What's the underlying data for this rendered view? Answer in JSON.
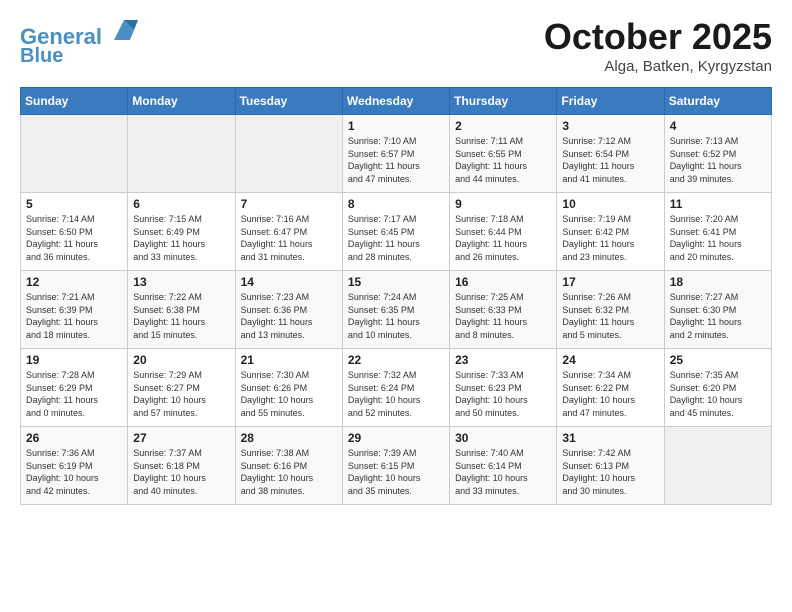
{
  "header": {
    "logo_line1": "General",
    "logo_line2": "Blue",
    "month_title": "October 2025",
    "subtitle": "Alga, Batken, Kyrgyzstan"
  },
  "days_of_week": [
    "Sunday",
    "Monday",
    "Tuesday",
    "Wednesday",
    "Thursday",
    "Friday",
    "Saturday"
  ],
  "weeks": [
    [
      {
        "day": "",
        "info": ""
      },
      {
        "day": "",
        "info": ""
      },
      {
        "day": "",
        "info": ""
      },
      {
        "day": "1",
        "info": "Sunrise: 7:10 AM\nSunset: 6:57 PM\nDaylight: 11 hours\nand 47 minutes."
      },
      {
        "day": "2",
        "info": "Sunrise: 7:11 AM\nSunset: 6:55 PM\nDaylight: 11 hours\nand 44 minutes."
      },
      {
        "day": "3",
        "info": "Sunrise: 7:12 AM\nSunset: 6:54 PM\nDaylight: 11 hours\nand 41 minutes."
      },
      {
        "day": "4",
        "info": "Sunrise: 7:13 AM\nSunset: 6:52 PM\nDaylight: 11 hours\nand 39 minutes."
      }
    ],
    [
      {
        "day": "5",
        "info": "Sunrise: 7:14 AM\nSunset: 6:50 PM\nDaylight: 11 hours\nand 36 minutes."
      },
      {
        "day": "6",
        "info": "Sunrise: 7:15 AM\nSunset: 6:49 PM\nDaylight: 11 hours\nand 33 minutes."
      },
      {
        "day": "7",
        "info": "Sunrise: 7:16 AM\nSunset: 6:47 PM\nDaylight: 11 hours\nand 31 minutes."
      },
      {
        "day": "8",
        "info": "Sunrise: 7:17 AM\nSunset: 6:45 PM\nDaylight: 11 hours\nand 28 minutes."
      },
      {
        "day": "9",
        "info": "Sunrise: 7:18 AM\nSunset: 6:44 PM\nDaylight: 11 hours\nand 26 minutes."
      },
      {
        "day": "10",
        "info": "Sunrise: 7:19 AM\nSunset: 6:42 PM\nDaylight: 11 hours\nand 23 minutes."
      },
      {
        "day": "11",
        "info": "Sunrise: 7:20 AM\nSunset: 6:41 PM\nDaylight: 11 hours\nand 20 minutes."
      }
    ],
    [
      {
        "day": "12",
        "info": "Sunrise: 7:21 AM\nSunset: 6:39 PM\nDaylight: 11 hours\nand 18 minutes."
      },
      {
        "day": "13",
        "info": "Sunrise: 7:22 AM\nSunset: 6:38 PM\nDaylight: 11 hours\nand 15 minutes."
      },
      {
        "day": "14",
        "info": "Sunrise: 7:23 AM\nSunset: 6:36 PM\nDaylight: 11 hours\nand 13 minutes."
      },
      {
        "day": "15",
        "info": "Sunrise: 7:24 AM\nSunset: 6:35 PM\nDaylight: 11 hours\nand 10 minutes."
      },
      {
        "day": "16",
        "info": "Sunrise: 7:25 AM\nSunset: 6:33 PM\nDaylight: 11 hours\nand 8 minutes."
      },
      {
        "day": "17",
        "info": "Sunrise: 7:26 AM\nSunset: 6:32 PM\nDaylight: 11 hours\nand 5 minutes."
      },
      {
        "day": "18",
        "info": "Sunrise: 7:27 AM\nSunset: 6:30 PM\nDaylight: 11 hours\nand 2 minutes."
      }
    ],
    [
      {
        "day": "19",
        "info": "Sunrise: 7:28 AM\nSunset: 6:29 PM\nDaylight: 11 hours\nand 0 minutes."
      },
      {
        "day": "20",
        "info": "Sunrise: 7:29 AM\nSunset: 6:27 PM\nDaylight: 10 hours\nand 57 minutes."
      },
      {
        "day": "21",
        "info": "Sunrise: 7:30 AM\nSunset: 6:26 PM\nDaylight: 10 hours\nand 55 minutes."
      },
      {
        "day": "22",
        "info": "Sunrise: 7:32 AM\nSunset: 6:24 PM\nDaylight: 10 hours\nand 52 minutes."
      },
      {
        "day": "23",
        "info": "Sunrise: 7:33 AM\nSunset: 6:23 PM\nDaylight: 10 hours\nand 50 minutes."
      },
      {
        "day": "24",
        "info": "Sunrise: 7:34 AM\nSunset: 6:22 PM\nDaylight: 10 hours\nand 47 minutes."
      },
      {
        "day": "25",
        "info": "Sunrise: 7:35 AM\nSunset: 6:20 PM\nDaylight: 10 hours\nand 45 minutes."
      }
    ],
    [
      {
        "day": "26",
        "info": "Sunrise: 7:36 AM\nSunset: 6:19 PM\nDaylight: 10 hours\nand 42 minutes."
      },
      {
        "day": "27",
        "info": "Sunrise: 7:37 AM\nSunset: 6:18 PM\nDaylight: 10 hours\nand 40 minutes."
      },
      {
        "day": "28",
        "info": "Sunrise: 7:38 AM\nSunset: 6:16 PM\nDaylight: 10 hours\nand 38 minutes."
      },
      {
        "day": "29",
        "info": "Sunrise: 7:39 AM\nSunset: 6:15 PM\nDaylight: 10 hours\nand 35 minutes."
      },
      {
        "day": "30",
        "info": "Sunrise: 7:40 AM\nSunset: 6:14 PM\nDaylight: 10 hours\nand 33 minutes."
      },
      {
        "day": "31",
        "info": "Sunrise: 7:42 AM\nSunset: 6:13 PM\nDaylight: 10 hours\nand 30 minutes."
      },
      {
        "day": "",
        "info": ""
      }
    ]
  ]
}
